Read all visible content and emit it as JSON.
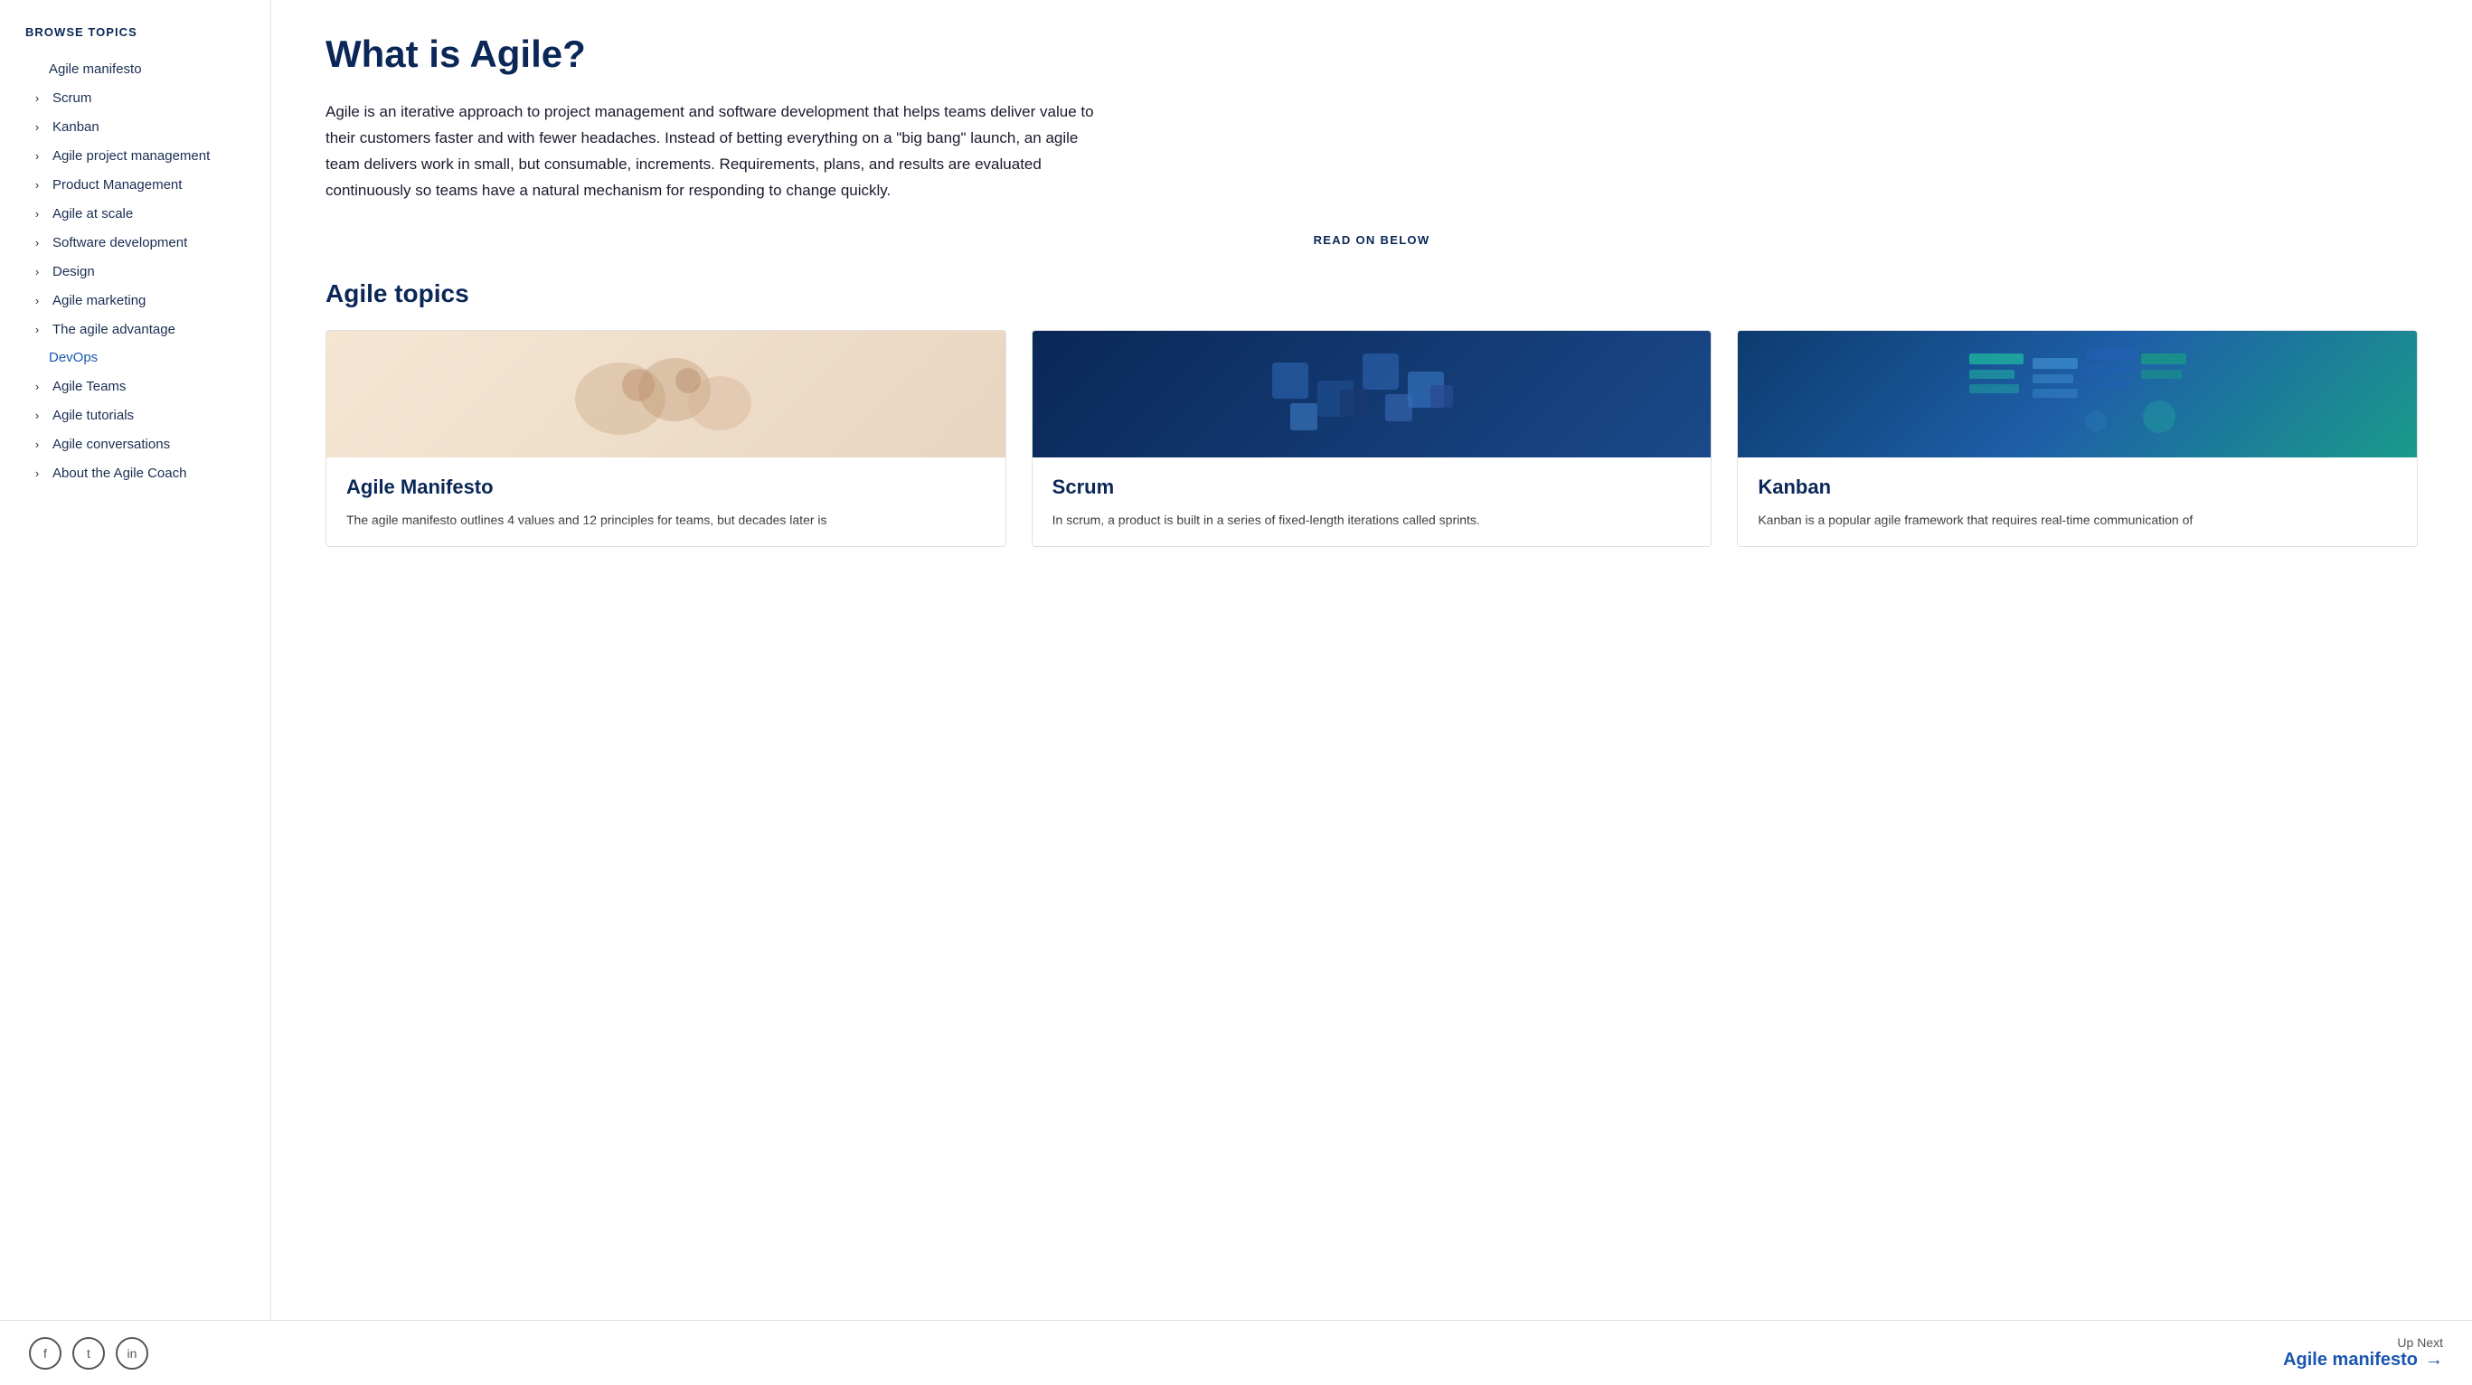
{
  "sidebar": {
    "browse_topics_label": "BROWSE TOPICS",
    "items": [
      {
        "id": "agile-manifesto",
        "label": "Agile manifesto",
        "has_chevron": false,
        "is_link": false,
        "special_class": ""
      },
      {
        "id": "scrum",
        "label": "Scrum",
        "has_chevron": true,
        "is_link": false,
        "special_class": ""
      },
      {
        "id": "kanban",
        "label": "Kanban",
        "has_chevron": true,
        "is_link": false,
        "special_class": ""
      },
      {
        "id": "agile-project-management",
        "label": "Agile project management",
        "has_chevron": true,
        "is_link": false,
        "special_class": ""
      },
      {
        "id": "product-management",
        "label": "Product Management",
        "has_chevron": true,
        "is_link": false,
        "special_class": ""
      },
      {
        "id": "agile-at-scale",
        "label": "Agile at scale",
        "has_chevron": true,
        "is_link": false,
        "special_class": ""
      },
      {
        "id": "software-development",
        "label": "Software development",
        "has_chevron": true,
        "is_link": false,
        "special_class": ""
      },
      {
        "id": "design",
        "label": "Design",
        "has_chevron": true,
        "is_link": false,
        "special_class": ""
      },
      {
        "id": "agile-marketing",
        "label": "Agile marketing",
        "has_chevron": true,
        "is_link": false,
        "special_class": ""
      },
      {
        "id": "agile-advantage",
        "label": "The agile advantage",
        "has_chevron": true,
        "is_link": false,
        "special_class": ""
      },
      {
        "id": "devops",
        "label": "DevOps",
        "has_chevron": false,
        "is_link": true,
        "special_class": "devops"
      },
      {
        "id": "agile-teams",
        "label": "Agile Teams",
        "has_chevron": true,
        "is_link": false,
        "special_class": ""
      },
      {
        "id": "agile-tutorials",
        "label": "Agile tutorials",
        "has_chevron": true,
        "is_link": false,
        "special_class": ""
      },
      {
        "id": "agile-conversations",
        "label": "Agile conversations",
        "has_chevron": true,
        "is_link": false,
        "special_class": ""
      },
      {
        "id": "agile-coach",
        "label": "About the Agile Coach",
        "has_chevron": true,
        "is_link": false,
        "special_class": ""
      }
    ]
  },
  "main": {
    "page_title": "What is Agile?",
    "intro_text": "Agile is an iterative approach to project management and software development that helps teams deliver value to their customers faster and with fewer headaches. Instead of betting everything on a \"big bang\" launch, an agile team delivers work in small, but consumable, increments. Requirements, plans, and results are evaluated continuously so teams have a natural mechanism for responding to change quickly.",
    "read_on_below": "READ ON BELOW",
    "agile_topics_title": "Agile topics",
    "cards": [
      {
        "id": "agile-manifesto-card",
        "image_type": "manifesto",
        "title": "Agile Manifesto",
        "description": "The agile manifesto outlines 4 values and 12 principles for teams, but decades later is"
      },
      {
        "id": "scrum-card",
        "image_type": "scrum",
        "title": "Scrum",
        "description": "In scrum, a product is built in a series of fixed-length iterations called sprints."
      },
      {
        "id": "kanban-card",
        "image_type": "kanban",
        "title": "Kanban",
        "description": "Kanban is a popular agile framework that requires real-time communication of"
      }
    ]
  },
  "footer": {
    "social": [
      {
        "id": "facebook",
        "label": "f"
      },
      {
        "id": "twitter",
        "label": "t"
      },
      {
        "id": "linkedin",
        "label": "in"
      }
    ],
    "up_next_label": "Up Next",
    "up_next_link": "Agile manifesto",
    "up_next_arrow": "→"
  }
}
